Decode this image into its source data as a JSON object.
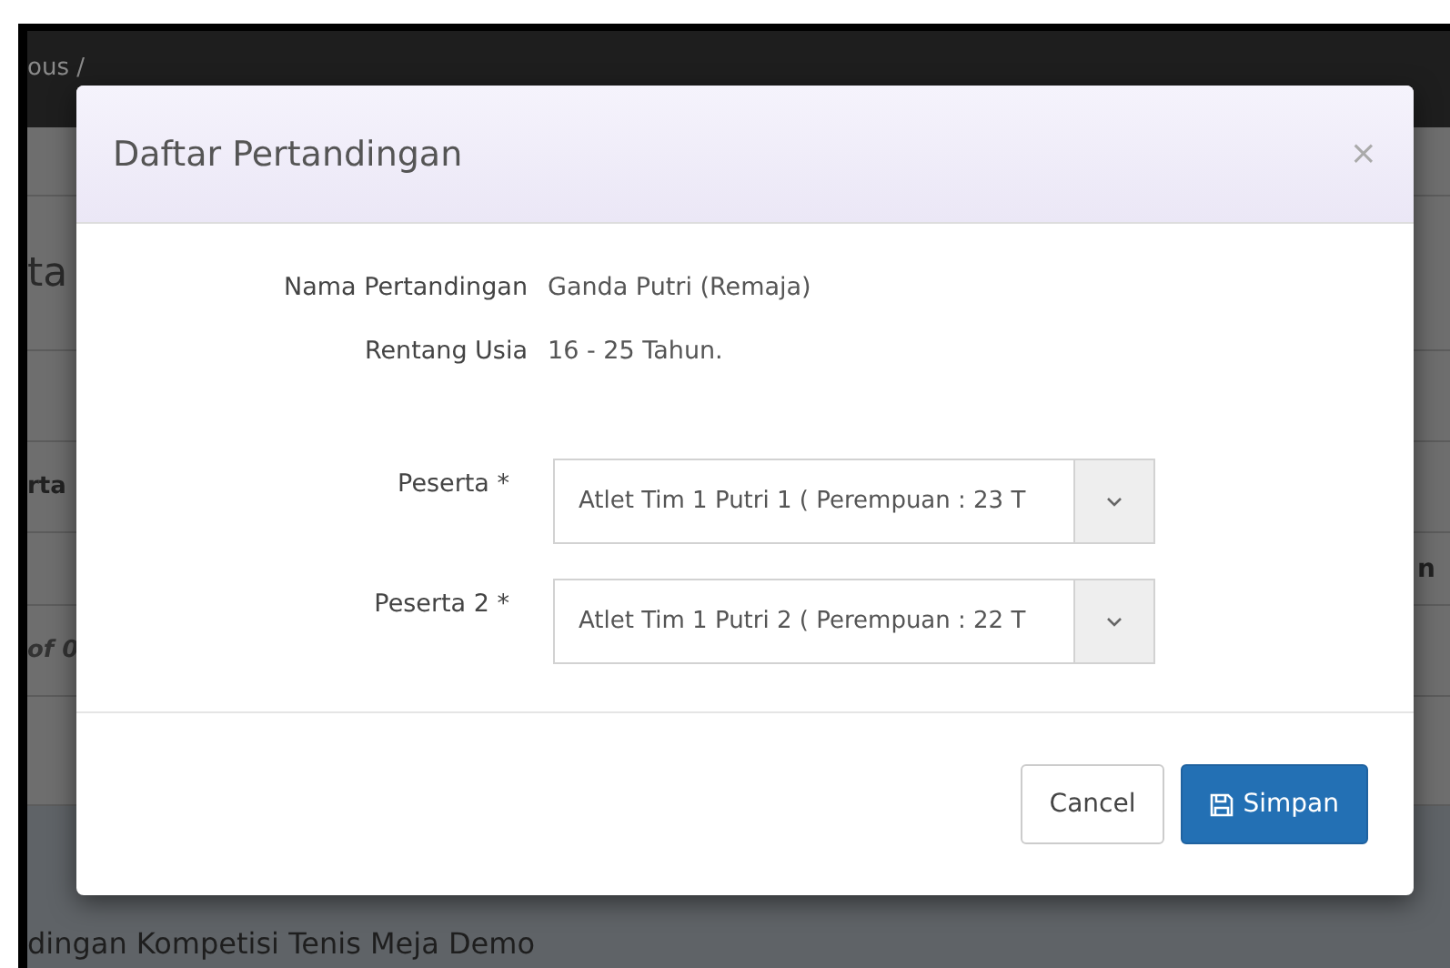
{
  "background": {
    "breadcrumb": "ous /",
    "heading_fragment": "ta",
    "column_fragment": "rta",
    "right_fragment": "n",
    "pager_fragment": "of 0",
    "footer_title": "dingan Kompetisi Tenis Meja Demo"
  },
  "modal": {
    "title": "Daftar Pertandingan",
    "close": "×",
    "info": [
      {
        "label": "Nama Pertandingan",
        "value": "Ganda Putri (Remaja)"
      },
      {
        "label": "Rentang Usia",
        "value": "16 - 25 Tahun."
      }
    ],
    "fields": [
      {
        "label": "Peserta *",
        "value": "Atlet Tim 1 Putri 1 ( Perempuan : 23 T"
      },
      {
        "label": "Peserta 2 *",
        "value": "Atlet Tim 1 Putri 2 ( Perempuan : 22 T"
      }
    ],
    "buttons": [
      {
        "kind": "default",
        "label": "Cancel"
      },
      {
        "kind": "primary",
        "label": "Simpan"
      }
    ]
  }
}
